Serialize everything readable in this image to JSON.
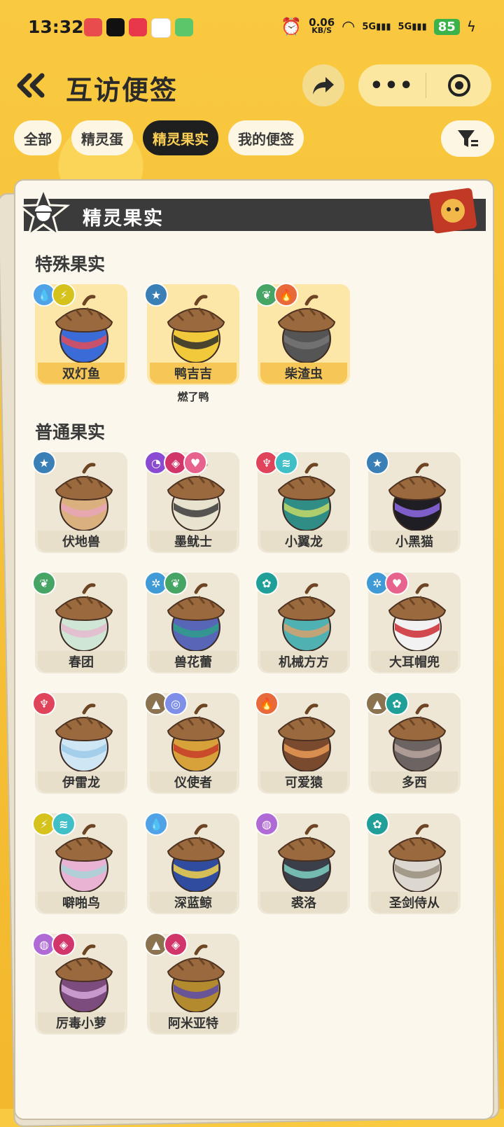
{
  "status": {
    "time": "13:32",
    "speed_value": "0.06",
    "speed_unit": "KB/S",
    "battery": "85",
    "net1": "5G",
    "net2": "5G"
  },
  "header": {
    "title": "互访便签",
    "more": "•••"
  },
  "tabs": [
    {
      "label": "全部",
      "active": false
    },
    {
      "label": "精灵蛋",
      "active": false
    },
    {
      "label": "精灵果实",
      "active": true
    },
    {
      "label": "我的便签",
      "active": false
    }
  ],
  "card": {
    "banner_title": "精灵果实"
  },
  "sections": {
    "special": {
      "title": "特殊果实",
      "items": [
        {
          "name": "双灯鱼",
          "note": "",
          "badges": [
            "water",
            "electric"
          ],
          "cap": "#3a6bd6",
          "band": "#e24d58"
        },
        {
          "name": "鸭吉吉",
          "note": "燃了鸭",
          "badges": [
            "normal"
          ],
          "cap": "#f1c93a",
          "band": "#2d2d2d"
        },
        {
          "name": "柴渣虫",
          "note": "",
          "badges": [
            "grass",
            "fire"
          ],
          "cap": "#555555",
          "band": "#777777"
        }
      ]
    },
    "normal": {
      "title": "普通果实",
      "items": [
        {
          "name": "伏地兽",
          "badges": [
            "normal"
          ],
          "cap": "#d9b07e",
          "band": "#e9a6b8"
        },
        {
          "name": "墨鱿士",
          "badges": [
            "ghost",
            "demon",
            "cute"
          ],
          "cap": "#e8e3cf",
          "band": "#3b3b3b"
        },
        {
          "name": "小翼龙",
          "badges": [
            "dragon",
            "wing"
          ],
          "cap": "#2f8d86",
          "band": "#c4d96a"
        },
        {
          "name": "小黑猫",
          "badges": [
            "normal"
          ],
          "cap": "#1e1e24",
          "band": "#8f6be6"
        },
        {
          "name": "春团",
          "badges": [
            "grass"
          ],
          "cap": "#cfe6d4",
          "band": "#e6b9cf"
        },
        {
          "name": "兽花蕾",
          "badges": [
            "ice",
            "grass"
          ],
          "cap": "#5866b8",
          "band": "#2e9e8a"
        },
        {
          "name": "机械方方",
          "badges": [
            "mech"
          ],
          "cap": "#4fb1b1",
          "band": "#d6a26f"
        },
        {
          "name": "大耳帽兜",
          "badges": [
            "ice",
            "cute"
          ],
          "cap": "#f2f2f2",
          "band": "#cc2a33"
        },
        {
          "name": "伊雷龙",
          "badges": [
            "dragon"
          ],
          "cap": "#cfe6f5",
          "band": "#9cc9e6"
        },
        {
          "name": "仪使者",
          "badges": [
            "ground",
            "psychic"
          ],
          "cap": "#d8a23a",
          "band": "#c83c2a"
        },
        {
          "name": "可爱猿",
          "badges": [
            "fire"
          ],
          "cap": "#7a4a2e",
          "band": "#e89a54"
        },
        {
          "name": "多西",
          "badges": [
            "ground",
            "mech"
          ],
          "cap": "#6c6462",
          "band": "#b9a6a0"
        },
        {
          "name": "噼啪鸟",
          "badges": [
            "electric",
            "wing"
          ],
          "cap": "#e9b3d4",
          "band": "#a8d3d8"
        },
        {
          "name": "深蓝鲸",
          "badges": [
            "water"
          ],
          "cap": "#2f4c9e",
          "band": "#f2d24a"
        },
        {
          "name": "裘洛",
          "badges": [
            "poison"
          ],
          "cap": "#3a3f4a",
          "band": "#7fd0c2"
        },
        {
          "name": "圣剑侍从",
          "badges": [
            "mech"
          ],
          "cap": "#ddd8cf",
          "band": "#9a8f7c"
        },
        {
          "name": "厉毒小萝",
          "badges": [
            "poison",
            "demon"
          ],
          "cap": "#7d4c7e",
          "band": "#d5a7d9"
        },
        {
          "name": "阿米亚特",
          "badges": [
            "ground",
            "demon"
          ],
          "cap": "#b48a2e",
          "band": "#5b4aa8"
        }
      ]
    }
  },
  "badge_colors": {
    "water": "#4fa2e6",
    "electric": "#d6c21c",
    "normal": "#3b7fb7",
    "grass": "#46a464",
    "fire": "#e86a3a",
    "ghost": "#8a4ad1",
    "demon": "#d2356a",
    "cute": "#e7638e",
    "dragon": "#e0445a",
    "wing": "#41bfc6",
    "ice": "#3f9ad6",
    "mech": "#1f9f97",
    "ground": "#8b7350",
    "psychic": "#7f8ee8",
    "poison": "#b06ad6"
  }
}
